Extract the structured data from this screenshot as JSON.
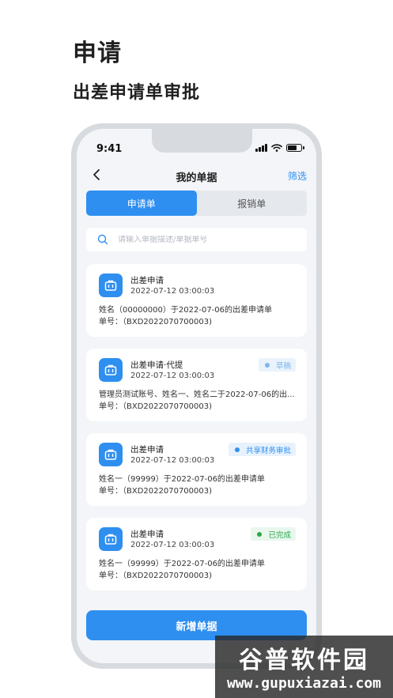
{
  "hero": {
    "title": "申请",
    "subtitle": "出差申请单审批"
  },
  "status_bar": {
    "time": "9:41"
  },
  "nav": {
    "title": "我的单据",
    "filter_label": "筛选"
  },
  "tabs": [
    {
      "label": "申请单",
      "active": true
    },
    {
      "label": "报销单",
      "active": false
    }
  ],
  "search": {
    "placeholder": "请输入单据描述/单据单号"
  },
  "cards": [
    {
      "title": "出差申请",
      "time": "2022-07-12 03:00:03",
      "desc": "姓名（00000000）于2022-07-06的出差申请单",
      "number": "单号：（BXD2022070700003)",
      "badge": null
    },
    {
      "title": "出差申请·代提",
      "time": "2022-07-12 03:00:03",
      "desc": "管理员测试账号、姓名一、姓名二于2022-07-06的出...",
      "number": "单号：（BXD2022070700003)",
      "badge": {
        "label": "草稿",
        "color": "#7fb6ec",
        "bg": "#eaf3fc"
      }
    },
    {
      "title": "出差申请",
      "time": "2022-07-12 03:00:03",
      "desc": "姓名一（99999）于2022-07-06的出差申请单",
      "number": "单号：（BXD2022070700003)",
      "badge": {
        "label": "共享财务审批",
        "color": "#2e8ff0",
        "bg": "#e8f2fd"
      }
    },
    {
      "title": "出差申请",
      "time": "2022-07-12 03:00:03",
      "desc": "姓名一（99999）于2022-07-06的出差申请单",
      "number": "单号：（BXD2022070700003)",
      "badge": {
        "label": "已完成",
        "color": "#2aa84a",
        "bg": "#e9f7ee"
      }
    }
  ],
  "bottom_button": {
    "label": "新增单据"
  },
  "watermark": {
    "title": "谷普软件园",
    "url": "www.gupuxiazai.com"
  },
  "colors": {
    "accent": "#2e8ff0",
    "screen_bg": "#f3f5f8"
  }
}
